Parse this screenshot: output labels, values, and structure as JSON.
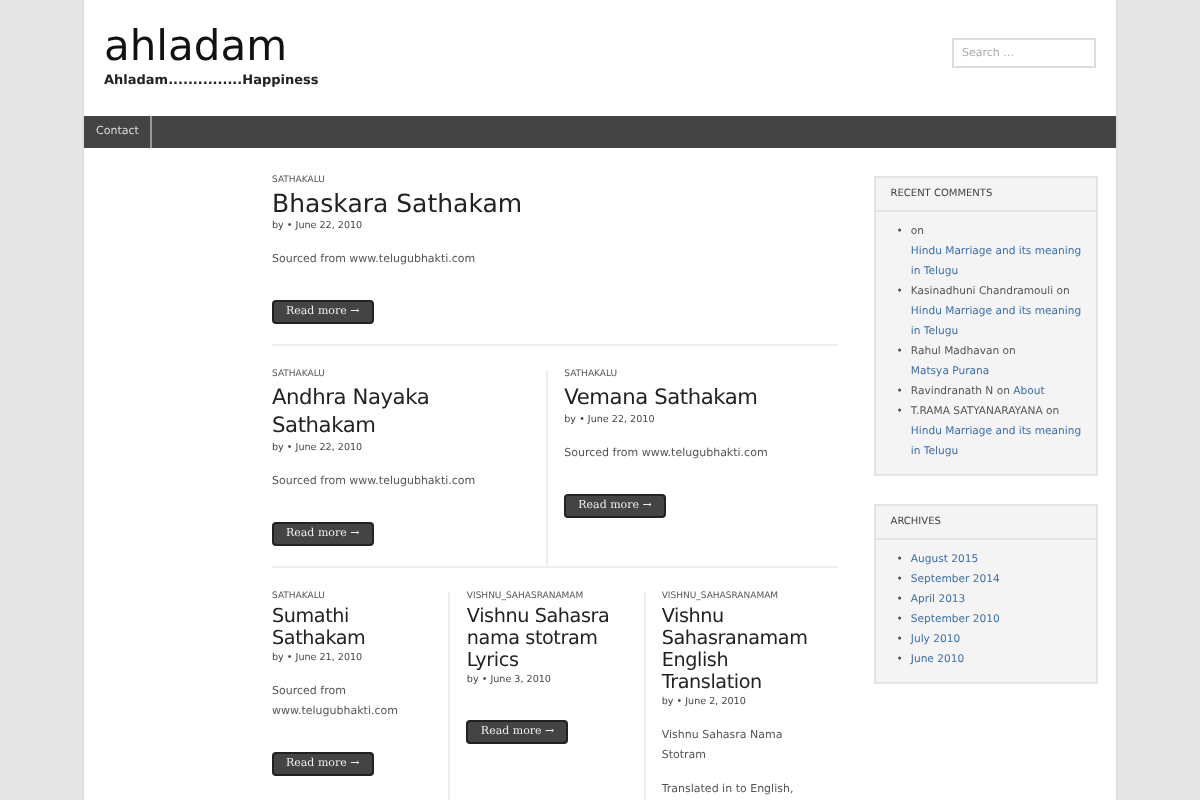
{
  "site": {
    "title": "ahladam",
    "tagline": "Ahladam...............Happiness"
  },
  "search": {
    "placeholder": "Search …"
  },
  "nav": [
    {
      "label": "Contact",
      "selected": false
    }
  ],
  "post_rows": [
    [
      {
        "category": "SATHAKALU",
        "title": "Bhaskara Sathakam",
        "by": "by",
        "date": "• June 22, 2010",
        "excerpt": [
          "Sourced from www.telugubhakti.com"
        ],
        "button": "Read more →"
      }
    ],
    [
      {
        "category": "SATHAKALU",
        "title": "Andhra Nayaka Sathakam",
        "by": "by",
        "date": "• June 22, 2010",
        "excerpt": [
          "Sourced from www.telugubhakti.com"
        ],
        "button": "Read more →"
      },
      {
        "category": "SATHAKALU",
        "title": "Vemana Sathakam",
        "by": "by",
        "date": "• June 22, 2010",
        "excerpt": [
          "Sourced from www.telugubhakti.com"
        ],
        "button": "Read more →"
      }
    ],
    [
      {
        "category": "SATHAKALU",
        "title": "Sumathi Sathakam",
        "by": "by",
        "date": "• June 21, 2010",
        "excerpt": [
          "Sourced from www.telugubhakti.com"
        ],
        "button": "Read more →"
      },
      {
        "category": "VISHNU_SAHASRANAMAM",
        "title": "Vishnu Sahasra nama stotram Lyrics",
        "by": "by",
        "date": "• June 3, 2010",
        "button": "Read more →"
      },
      {
        "category": "VISHNU_SAHASRANAMAM",
        "title": "Vishnu Sahasranamam English Translation",
        "by": "by",
        "date": "• June 2, 2010",
        "excerpt": [
          "Vishnu Sahasra Nama Stotram",
          "Translated in to English,"
        ]
      }
    ]
  ],
  "sidebar": [
    {
      "title": "RECENT COMMENTS",
      "items": [
        {
          "bullet": "•",
          "author": "on",
          "link": "Hindu Marriage and its meaning in Telugu"
        },
        {
          "bullet": "•",
          "author": "Kasinadhuni Chandramouli on",
          "link": "Hindu Marriage and its meaning in Telugu"
        },
        {
          "bullet": "•",
          "author": "Rahul Madhavan on",
          "link": "Matsya Purana"
        },
        {
          "bullet": "•",
          "author": "Ravindranath N on",
          "link": "About"
        },
        {
          "bullet": "•",
          "author": "T.RAMA SATYANARAYANA on",
          "link": "Hindu Marriage and its meaning in Telugu"
        }
      ]
    },
    {
      "title": "ARCHIVES",
      "items": [
        {
          "bullet": "•",
          "link": "August 2015"
        },
        {
          "bullet": "•",
          "link": "September 2014"
        },
        {
          "bullet": "•",
          "link": "April 2013"
        },
        {
          "bullet": "•",
          "link": "September 2010"
        },
        {
          "bullet": "•",
          "link": "July 2010"
        },
        {
          "bullet": "•",
          "link": "June 2010"
        }
      ]
    }
  ]
}
